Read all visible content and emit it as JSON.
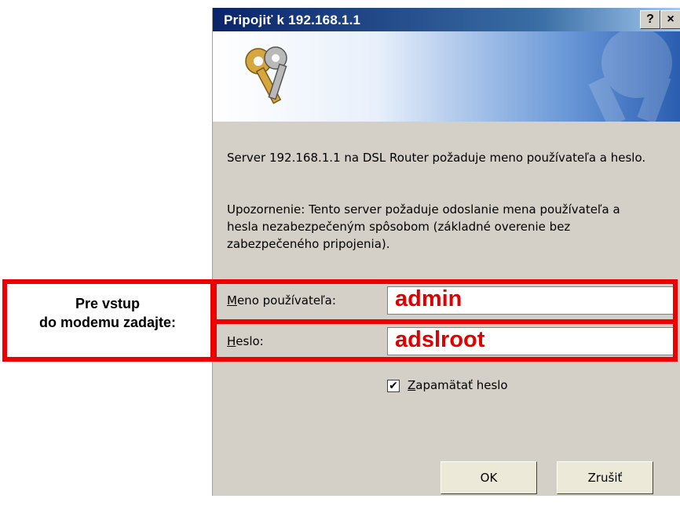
{
  "dialog": {
    "title": "Pripojiť k 192.168.1.1",
    "help_label": "?",
    "close_label": "×",
    "message1": "Server 192.168.1.1 na DSL Router požaduje meno používateľa a heslo.",
    "message2": "Upozornenie: Tento server požaduje odoslanie mena používateľa a hesla nezabezpečeným spôsobom (základné overenie bez zabezpečeného pripojenia).",
    "username_label_first": "M",
    "username_label_rest": "eno používateľa:",
    "username_value": "admin",
    "password_label_first": "H",
    "password_label_rest": "eslo:",
    "password_value": "adslroot",
    "remember_label_first": "Z",
    "remember_label_rest": "apamätať heslo",
    "remember_checked": true,
    "ok_label": "OK",
    "cancel_label": "Zrušiť"
  },
  "annotation": {
    "line1": "Pre vstup",
    "line2": "do modemu zadajte:",
    "color": "#ee0000"
  }
}
